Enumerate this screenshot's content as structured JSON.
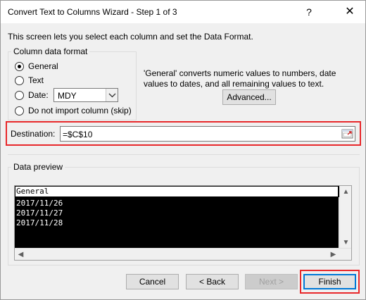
{
  "window": {
    "title": "Convert Text to Columns Wizard - Step 1 of 3",
    "help_glyph": "?",
    "close_glyph": "✕"
  },
  "intro": "This screen lets you select each column and set the Data Format.",
  "column_format": {
    "legend": "Column data format",
    "options": [
      {
        "label": "General",
        "checked": true
      },
      {
        "label": "Text",
        "checked": false
      },
      {
        "label": "Date:",
        "checked": false
      },
      {
        "label": "Do not import column (skip)",
        "checked": false
      }
    ],
    "date_format": "MDY"
  },
  "description": "'General' converts numeric values to numbers, date values to dates, and all remaining values to text.",
  "advanced_label": "Advanced...",
  "destination": {
    "label": "Destination:",
    "value": "=$C$10"
  },
  "preview": {
    "legend": "Data preview",
    "header": "General",
    "rows": [
      "2017/11/26",
      "2017/11/27",
      "2017/11/28"
    ]
  },
  "buttons": {
    "cancel": "Cancel",
    "back": "< Back",
    "next": "Next >",
    "finish": "Finish"
  },
  "colors": {
    "highlight": "#e8282b",
    "focus": "#0078d7"
  }
}
